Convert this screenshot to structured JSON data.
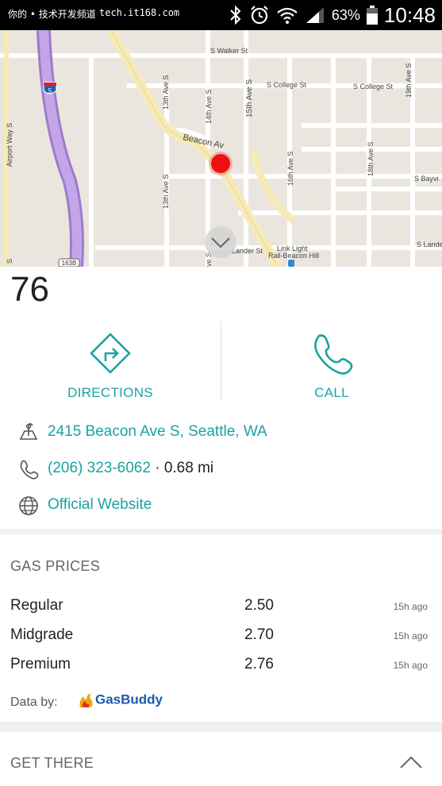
{
  "status_bar": {
    "left_text": "你的 • 技术开发频道",
    "watermark": "tech.it168.com",
    "battery": "63%",
    "time": "10:48"
  },
  "map": {
    "labels": {
      "walker": "S Walker St",
      "college1": "S College St",
      "college2": "S College St",
      "ave15": "15th Ave S",
      "ave19": "19th Ave S",
      "ave14": "14th Ave S",
      "ave13a": "13th Ave S",
      "ave13b": "13th Ave S",
      "ave16": "16th Ave S",
      "ave18": "18th Ave S",
      "airport": "Airport Way S",
      "beacon": "Beacon Av",
      "bayview": "S Bayvi",
      "lander": "Lander St",
      "lander2": "S Lande",
      "link": "Link Light",
      "rail": "Rail-Beacon Hill",
      "i5": "5",
      "exit": "163B",
      "aves_low": "S",
      "ave14_low": "ve S"
    }
  },
  "place": {
    "name": "76"
  },
  "actions": {
    "directions": "DIRECTIONS",
    "call": "CALL"
  },
  "info": {
    "address": "2415 Beacon Ave S, Seattle, WA",
    "phone": "(206) 323-6062",
    "distance_sep": "·",
    "distance": "0.68 mi",
    "website": "Official Website"
  },
  "gas": {
    "header": "GAS PRICES",
    "rows": [
      {
        "name": "Regular",
        "price": "2.50",
        "ago": "15h ago"
      },
      {
        "name": "Midgrade",
        "price": "2.70",
        "ago": "15h ago"
      },
      {
        "name": "Premium",
        "price": "2.76",
        "ago": "15h ago"
      }
    ],
    "data_by": "Data by:",
    "provider": "GasBuddy"
  },
  "get_there": {
    "header": "GET THERE"
  },
  "colors": {
    "accent": "#1aa3a1",
    "pin": "#ee1111",
    "freeway": "#b38ad8"
  }
}
